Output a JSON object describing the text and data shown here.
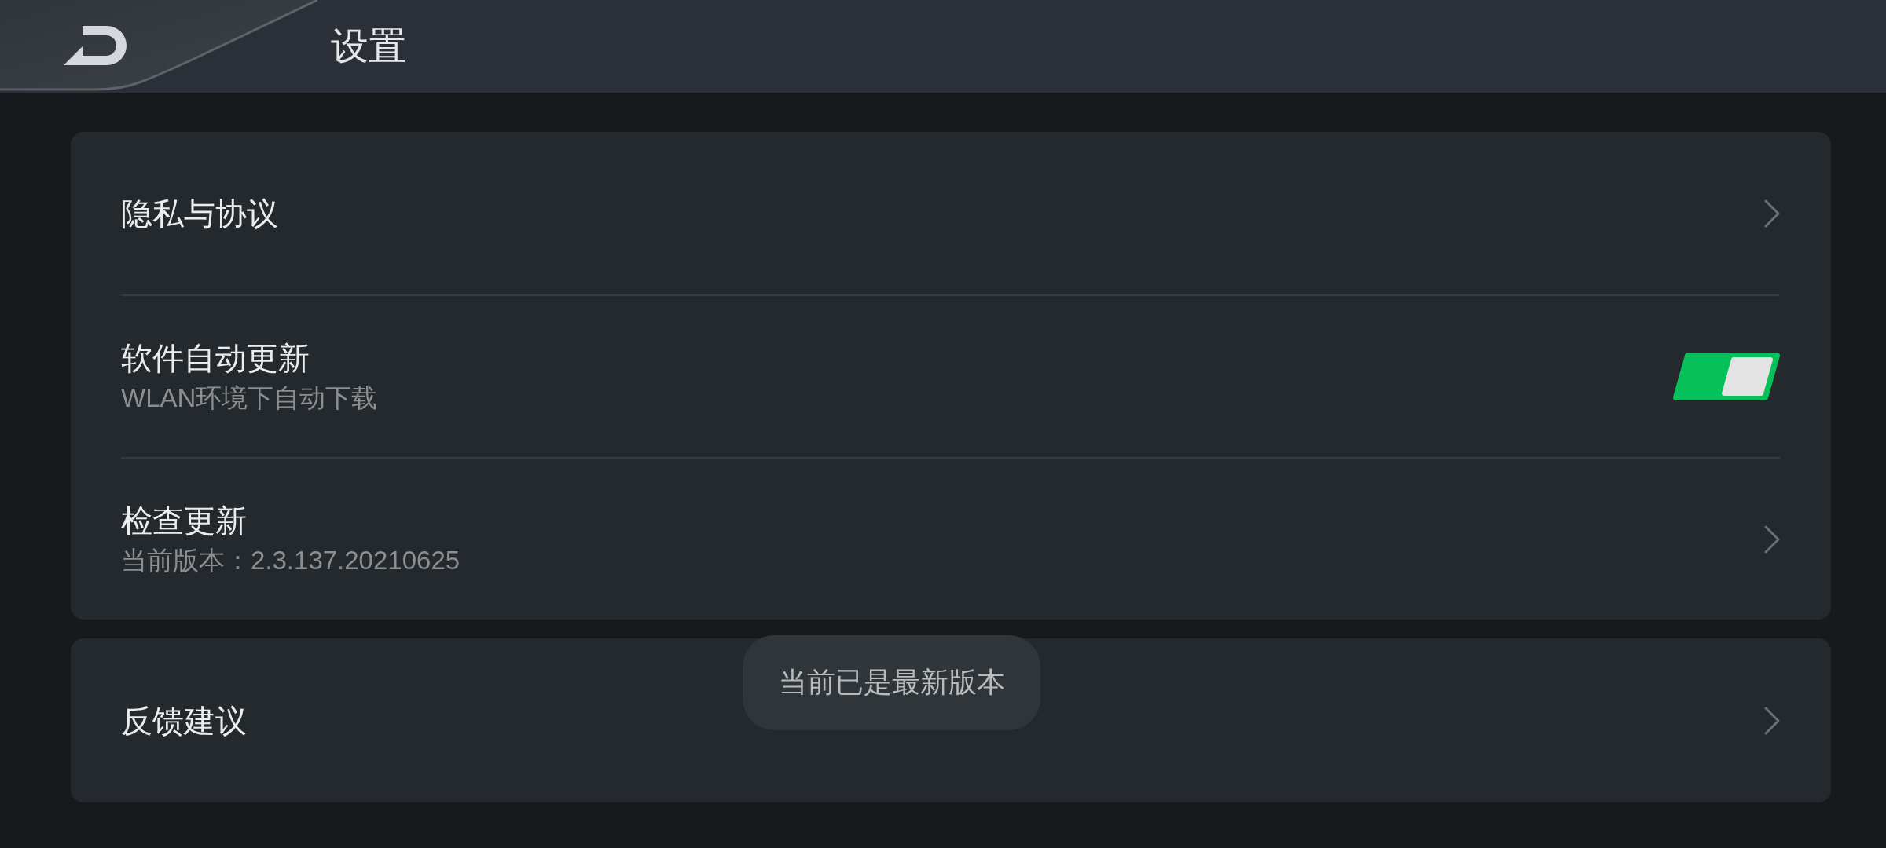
{
  "header": {
    "title": "设置"
  },
  "cards": [
    {
      "rows": [
        {
          "kind": "link",
          "title": "隐私与协议"
        },
        {
          "kind": "switch",
          "title": "软件自动更新",
          "subtitle": "WLAN环境下自动下载",
          "on": true
        },
        {
          "kind": "link",
          "title": "检查更新",
          "subtitle": "当前版本：2.3.137.20210625"
        }
      ]
    },
    {
      "rows": [
        {
          "kind": "link",
          "title": "反馈建议"
        }
      ]
    }
  ],
  "toast": {
    "text": "当前已是最新版本"
  }
}
